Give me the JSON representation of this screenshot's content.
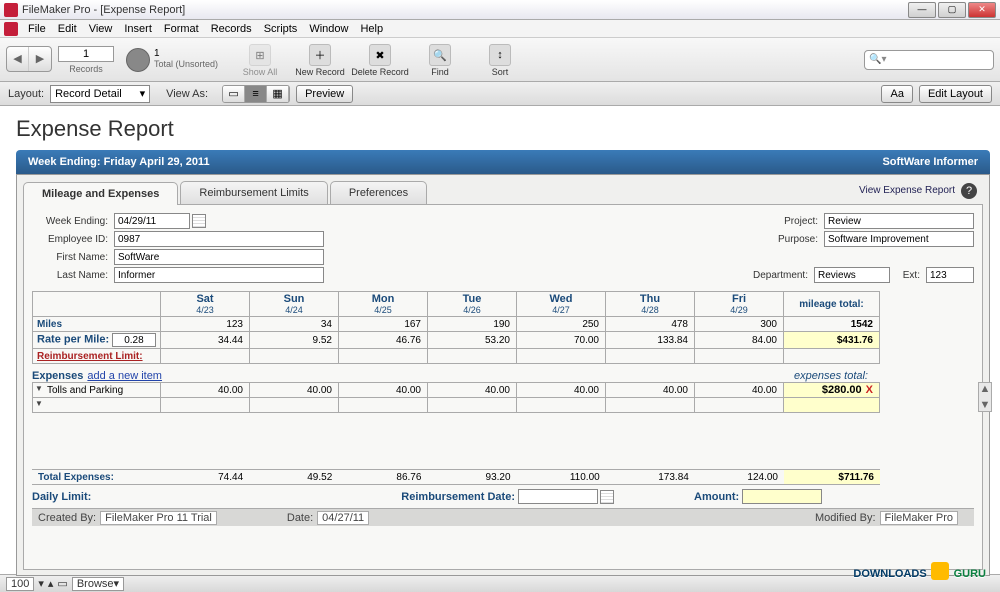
{
  "window": {
    "title": "FileMaker Pro - [Expense Report]"
  },
  "menu": [
    "File",
    "Edit",
    "View",
    "Insert",
    "Format",
    "Records",
    "Scripts",
    "Window",
    "Help"
  ],
  "toolbar": {
    "record_number": "1",
    "records_label": "Records",
    "total_count": "1",
    "total_label": "Total (Unsorted)",
    "buttons": {
      "show_all": "Show All",
      "new_record": "New Record",
      "delete_record": "Delete Record",
      "find": "Find",
      "sort": "Sort"
    },
    "search_placeholder": "Search"
  },
  "layoutbar": {
    "layout_label": "Layout:",
    "layout_value": "Record Detail",
    "view_as_label": "View As:",
    "preview": "Preview",
    "aa": "Aa",
    "edit_layout": "Edit Layout"
  },
  "page": {
    "title": "Expense Report",
    "header_left": "Week Ending: Friday April 29, 2011",
    "header_right": "SoftWare Informer",
    "view_report": "View Expense Report"
  },
  "tabs": [
    "Mileage and Expenses",
    "Reimbursement Limits",
    "Preferences"
  ],
  "form": {
    "week_ending_l": "Week Ending:",
    "week_ending": "04/29/11",
    "employee_id_l": "Employee ID:",
    "employee_id": "0987",
    "first_name_l": "First Name:",
    "first_name": "SoftWare",
    "last_name_l": "Last Name:",
    "last_name": "Informer",
    "project_l": "Project:",
    "project": "Review",
    "purpose_l": "Purpose:",
    "purpose": "Software Improvement",
    "department_l": "Department:",
    "department": "Reviews",
    "ext_l": "Ext:",
    "ext": "123"
  },
  "grid": {
    "days": [
      {
        "d": "Sat",
        "dt": "4/23"
      },
      {
        "d": "Sun",
        "dt": "4/24"
      },
      {
        "d": "Mon",
        "dt": "4/25"
      },
      {
        "d": "Tue",
        "dt": "4/26"
      },
      {
        "d": "Wed",
        "dt": "4/27"
      },
      {
        "d": "Thu",
        "dt": "4/28"
      },
      {
        "d": "Fri",
        "dt": "4/29"
      }
    ],
    "mileage_total_l": "mileage total:",
    "miles_l": "Miles",
    "miles": [
      "123",
      "34",
      "167",
      "190",
      "250",
      "478",
      "300"
    ],
    "miles_total": "1542",
    "rate_l": "Rate per Mile:",
    "rate": "0.28",
    "rate_vals": [
      "34.44",
      "9.52",
      "46.76",
      "53.20",
      "70.00",
      "133.84",
      "84.00"
    ],
    "rate_total": "$431.76",
    "reimb_l": "Reimbursement Limit:"
  },
  "expenses": {
    "heading": "Expenses",
    "add_link": "add a new item",
    "total_l": "expenses total:",
    "row1_label": "Tolls and Parking",
    "row1": [
      "40.00",
      "40.00",
      "40.00",
      "40.00",
      "40.00",
      "40.00",
      "40.00"
    ],
    "row1_total": "$280.00"
  },
  "totals": {
    "label": "Total Expenses:",
    "vals": [
      "74.44",
      "49.52",
      "86.76",
      "93.20",
      "110.00",
      "173.84",
      "124.00"
    ],
    "grand": "$711.76",
    "daily_l": "Daily Limit:",
    "reimb_date_l": "Reimbursement Date:",
    "amount_l": "Amount:"
  },
  "footer": {
    "created_l": "Created By:",
    "created": "FileMaker Pro 11 Trial",
    "date_l": "Date:",
    "date": "04/27/11",
    "modified_l": "Modified By:",
    "modified": "FileMaker Pro"
  },
  "status": {
    "zoom": "100",
    "mode": "Browse"
  },
  "watermark": {
    "a": "DOWNLOADS",
    "b": "GURU"
  }
}
